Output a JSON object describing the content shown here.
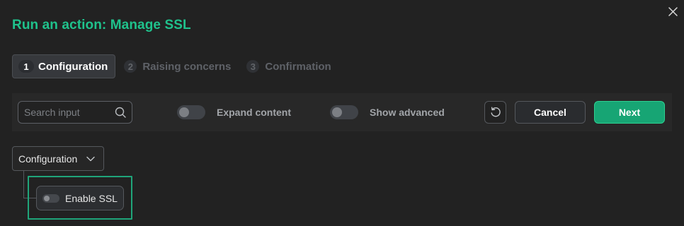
{
  "dialog": {
    "title": "Run an action: Manage SSL",
    "close_icon": "close-icon"
  },
  "steps": [
    {
      "number": "1",
      "label": "Configuration",
      "active": true
    },
    {
      "number": "2",
      "label": "Raising concerns",
      "active": false
    },
    {
      "number": "3",
      "label": "Confirmation",
      "active": false
    }
  ],
  "toolbar": {
    "search_placeholder": "Search input",
    "search_value": "",
    "search_icon": "search-icon",
    "expand_content_label": "Expand content",
    "expand_content_on": false,
    "show_advanced_label": "Show advanced",
    "show_advanced_on": false,
    "reset_icon": "reset-icon",
    "cancel_label": "Cancel",
    "next_label": "Next"
  },
  "tree": {
    "group_label": "Configuration",
    "group_icon": "chevron-down-icon",
    "option_label": "Enable SSL",
    "option_on": false
  },
  "colors": {
    "accent": "#1fc28c",
    "primary_button": "#17a574",
    "background": "#222222"
  }
}
